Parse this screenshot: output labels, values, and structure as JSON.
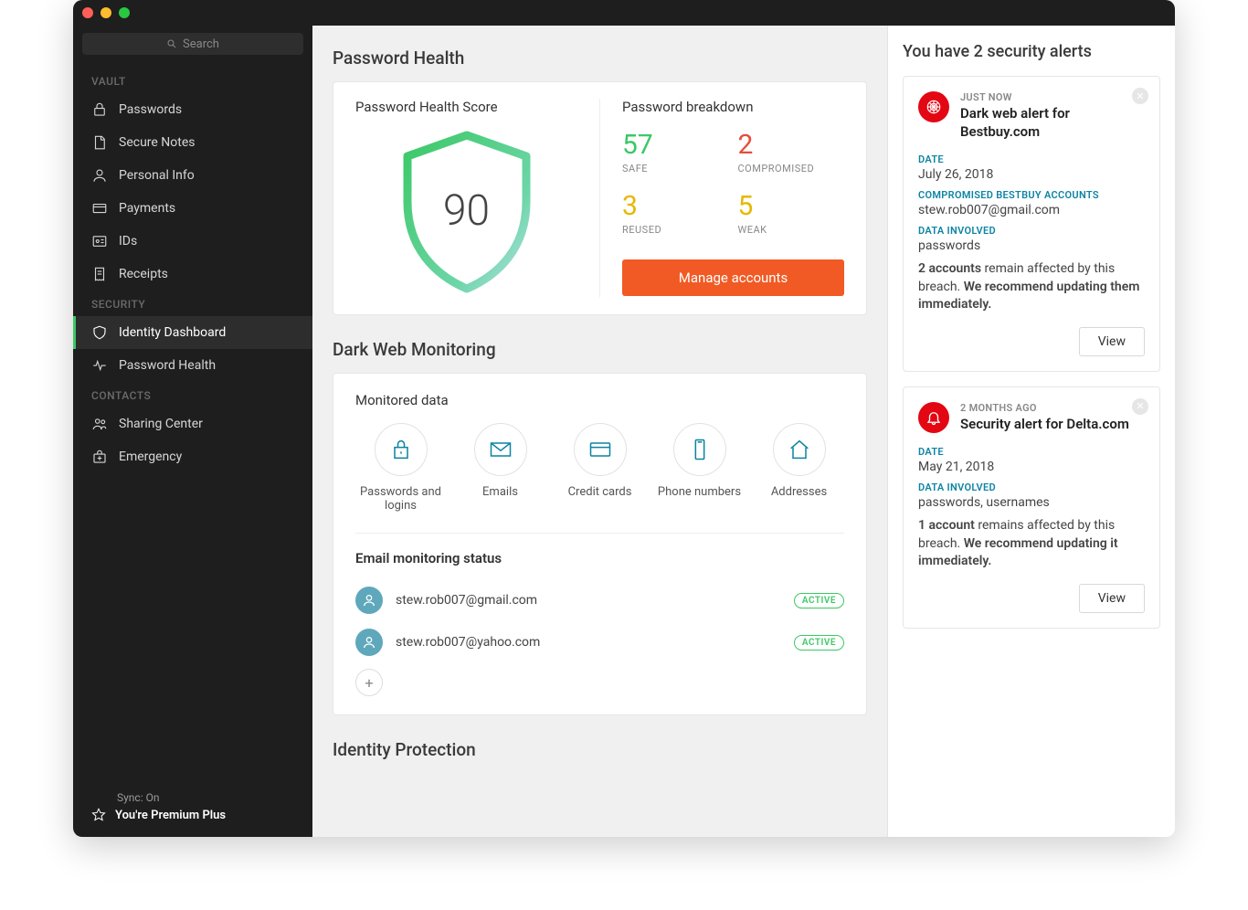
{
  "search": {
    "placeholder": "Search"
  },
  "sidebar": {
    "sections": {
      "vault": {
        "title": "VAULT",
        "items": [
          "Passwords",
          "Secure Notes",
          "Personal Info",
          "Payments",
          "IDs",
          "Receipts"
        ]
      },
      "security": {
        "title": "SECURITY",
        "items": [
          "Identity Dashboard",
          "Password Health"
        ]
      },
      "contacts": {
        "title": "CONTACTS",
        "items": [
          "Sharing Center",
          "Emergency"
        ]
      }
    },
    "footer": {
      "sync": "Sync: On",
      "premium": "You're Premium Plus"
    }
  },
  "password_health": {
    "heading": "Password Health",
    "score_label": "Password Health Score",
    "score": "90",
    "breakdown_label": "Password breakdown",
    "breakdown": {
      "safe": {
        "num": "57",
        "label": "SAFE"
      },
      "compromised": {
        "num": "2",
        "label": "COMPROMISED"
      },
      "reused": {
        "num": "3",
        "label": "REUSED"
      },
      "weak": {
        "num": "5",
        "label": "WEAK"
      }
    },
    "manage": "Manage accounts"
  },
  "dark_web": {
    "heading": "Dark Web Monitoring",
    "monitored_label": "Monitored data",
    "items": [
      "Passwords and logins",
      "Emails",
      "Credit cards",
      "Phone numbers",
      "Addresses"
    ],
    "email_status_title": "Email monitoring status",
    "emails": [
      {
        "addr": "stew.rob007@gmail.com",
        "status": "ACTIVE"
      },
      {
        "addr": "stew.rob007@yahoo.com",
        "status": "ACTIVE"
      }
    ]
  },
  "identity_protection": {
    "heading": "Identity Protection"
  },
  "alerts": {
    "title": "You have 2 security alerts",
    "list": [
      {
        "time": "JUST NOW",
        "title": "Dark web alert for Bestbuy.com",
        "date_label": "DATE",
        "date": "July 26, 2018",
        "accounts_label": "COMPROMISED BESTBUY ACCOUNTS",
        "accounts": "stew.rob007@gmail.com",
        "data_label": "DATA INVOLVED",
        "data": "passwords",
        "summary_count": "2 accounts",
        "summary_mid": " remain affected by this breach. ",
        "summary_bold": "We recommend updating them immediately.",
        "view": "View"
      },
      {
        "time": "2 MONTHS AGO",
        "title": "Security alert for Delta.com",
        "date_label": "DATE",
        "date": "May 21, 2018",
        "data_label": "DATA INVOLVED",
        "data": "passwords, usernames",
        "summary_count": "1 account",
        "summary_mid": " remains affected by this breach. ",
        "summary_bold": "We recommend updating it immediately.",
        "view": "View"
      }
    ]
  }
}
